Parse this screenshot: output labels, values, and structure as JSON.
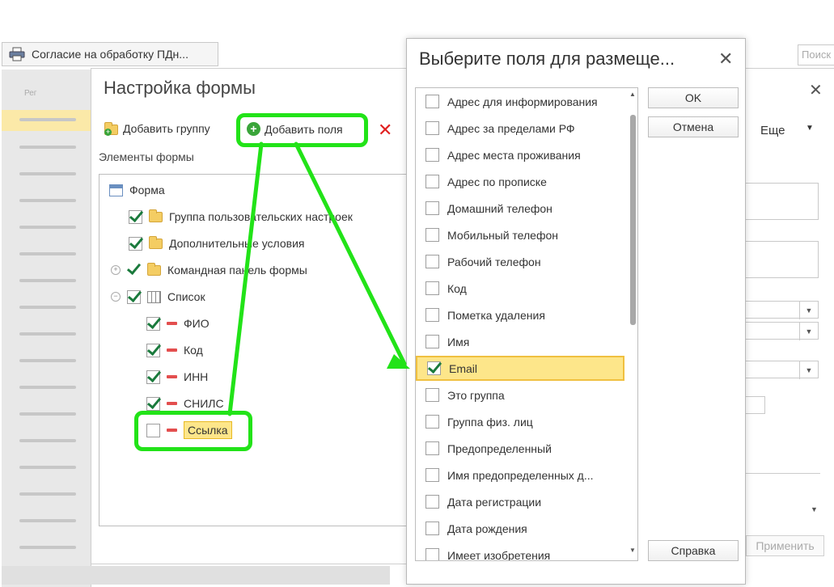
{
  "background": {
    "print_button_label": "Согласие на обработку ПДн...",
    "search_placeholder": "Поиск",
    "list_header": "Рег",
    "apply_label": "Применить",
    "more_label": "Еще"
  },
  "form_settings": {
    "title": "Настройка формы",
    "add_group_label": "Добавить группу",
    "add_fields_label": "Добавить поля",
    "elements_label": "Элементы формы",
    "tree": [
      {
        "label": "Форма",
        "level": 0,
        "checked": null,
        "icon": "form-icon"
      },
      {
        "label": "Группа пользовательских настроек",
        "level": 1,
        "checked": true,
        "icon": "folder-icon"
      },
      {
        "label": "Дополнительные условия",
        "level": 1,
        "checked": true,
        "icon": "folder-icon"
      },
      {
        "label": "Командная панель формы",
        "level": 1,
        "checked": true,
        "icon": "folder-icon",
        "expander": "+"
      },
      {
        "label": "Список",
        "level": 1,
        "checked": true,
        "icon": "table-icon",
        "expander": "−"
      },
      {
        "label": "ФИО",
        "level": 2,
        "checked": true,
        "icon": "minus-icon"
      },
      {
        "label": "Код",
        "level": 2,
        "checked": true,
        "icon": "minus-icon"
      },
      {
        "label": "ИНН",
        "level": 2,
        "checked": true,
        "icon": "minus-icon"
      },
      {
        "label": "СНИЛС",
        "level": 2,
        "checked": true,
        "icon": "minus-icon"
      },
      {
        "label": "Ссылка",
        "level": 2,
        "checked": false,
        "icon": "minus-icon",
        "highlighted": true
      }
    ]
  },
  "field_chooser": {
    "title": "Выберите поля для размеще...",
    "ok_label": "OK",
    "cancel_label": "Отмена",
    "help_label": "Справка",
    "items": [
      {
        "label": "Адрес для информирования",
        "checked": false
      },
      {
        "label": "Адрес за пределами РФ",
        "checked": false
      },
      {
        "label": "Адрес места проживания",
        "checked": false
      },
      {
        "label": "Адрес по прописке",
        "checked": false
      },
      {
        "label": "Домашний телефон",
        "checked": false
      },
      {
        "label": "Мобильный телефон",
        "checked": false
      },
      {
        "label": "Рабочий телефон",
        "checked": false
      },
      {
        "label": "Код",
        "checked": false
      },
      {
        "label": "Пометка удаления",
        "checked": false
      },
      {
        "label": "Имя",
        "checked": false
      },
      {
        "label": "Email",
        "checked": true,
        "selected": true
      },
      {
        "label": "Это группа",
        "checked": false
      },
      {
        "label": "Группа физ. лиц",
        "checked": false
      },
      {
        "label": "Предопределенный",
        "checked": false
      },
      {
        "label": "Имя предопределенных д...",
        "checked": false
      },
      {
        "label": "Дата регистрации",
        "checked": false
      },
      {
        "label": "Дата рождения",
        "checked": false
      },
      {
        "label": "Имеет изобретения",
        "checked": false
      }
    ]
  },
  "colors": {
    "annotation_green": "#22e318",
    "highlight_yellow": "#fde68a",
    "check_green": "#1a7a3c",
    "delete_red": "#e02020"
  }
}
